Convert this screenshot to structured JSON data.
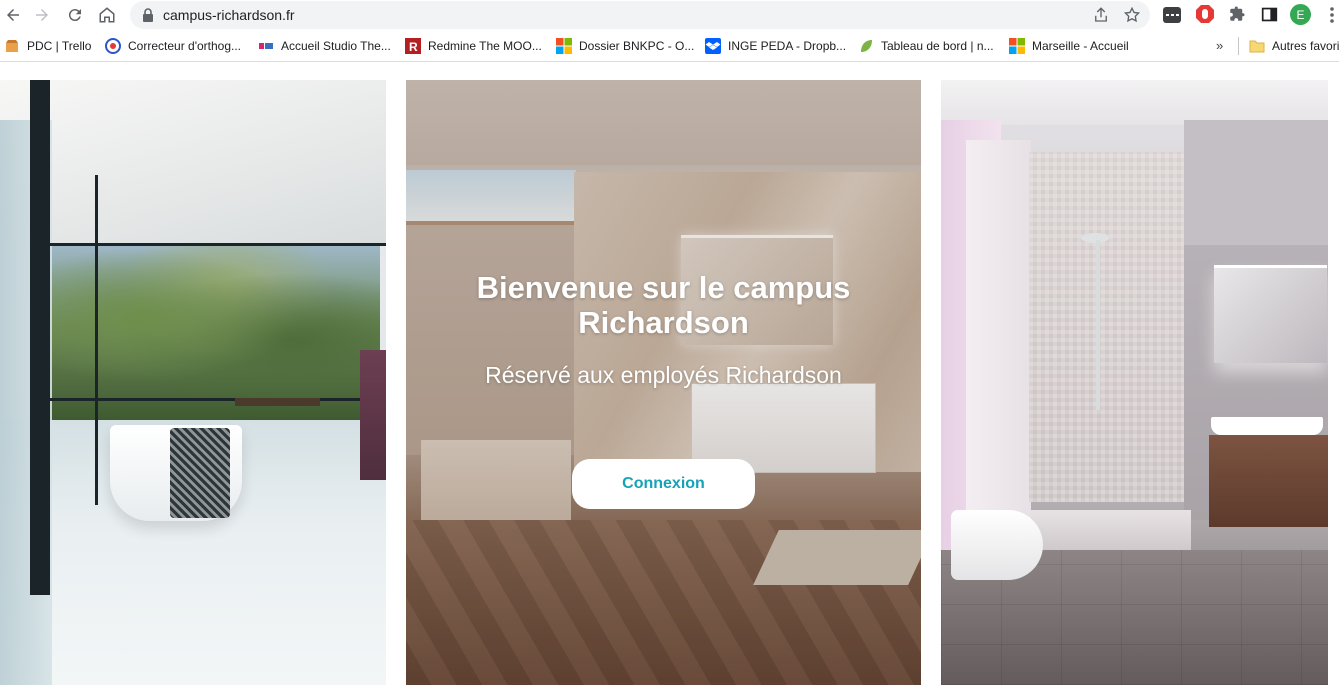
{
  "browser": {
    "url": "campus-richardson.fr",
    "profile_initial": "E",
    "nav_icons": [
      "back-arrow-icon",
      "forward-arrow-icon",
      "reload-icon",
      "home-icon"
    ]
  },
  "bookmarks": {
    "items": [
      {
        "label": "PDC | Trello",
        "icon": "trello-icon"
      },
      {
        "label": "Correcteur d'orthog...",
        "icon": "spellcheck-icon"
      },
      {
        "label": "Accueil Studio The...",
        "icon": "edx-icon"
      },
      {
        "label": "Redmine The MOO...",
        "icon": "redmine-icon"
      },
      {
        "label": "Dossier BNKPC - O...",
        "icon": "microsoft-icon"
      },
      {
        "label": "INGE PEDA - Dropb...",
        "icon": "dropbox-icon"
      },
      {
        "label": "Tableau de bord | n...",
        "icon": "leaf-icon"
      },
      {
        "label": "Marseille - Accueil",
        "icon": "microsoft-icon"
      }
    ],
    "more": "»",
    "other_folder": "Autres favori"
  },
  "hero": {
    "title": "Bienvenue sur le campus Richardson",
    "subtitle": "Réservé aux employés Richardson",
    "button_label": "Connexion",
    "button_text_color": "#17a2b8"
  },
  "colors": {
    "profile_avatar": "#34a853",
    "accent": "#17a2b8"
  }
}
